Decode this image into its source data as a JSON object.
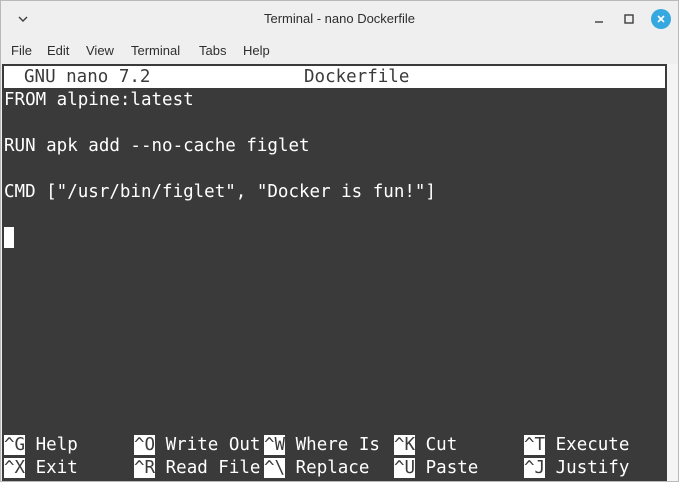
{
  "window": {
    "title": "Terminal - nano Dockerfile"
  },
  "menubar": {
    "items": [
      "File",
      "Edit",
      "View",
      "Terminal",
      "Tabs",
      "Help"
    ]
  },
  "nano": {
    "version": "GNU nano 7.2",
    "filename": "Dockerfile",
    "lines": [
      "FROM alpine:latest",
      "",
      "RUN apk add --no-cache figlet",
      "",
      "CMD [\"/usr/bin/figlet\", \"Docker is fun!\"]"
    ],
    "shortcuts": [
      {
        "key": "^G",
        "label": "Help"
      },
      {
        "key": "^O",
        "label": "Write Out"
      },
      {
        "key": "^W",
        "label": "Where Is"
      },
      {
        "key": "^K",
        "label": "Cut"
      },
      {
        "key": "^T",
        "label": "Execute"
      },
      {
        "key": "^X",
        "label": "Exit"
      },
      {
        "key": "^R",
        "label": "Read File"
      },
      {
        "key": "^\\",
        "label": "Replace"
      },
      {
        "key": "^U",
        "label": "Paste"
      },
      {
        "key": "^J",
        "label": "Justify"
      }
    ]
  },
  "icons": {
    "window_menu": "chevron-down-icon",
    "minimize": "minimize-icon",
    "maximize": "maximize-icon",
    "close": "close-icon"
  },
  "colors": {
    "terminal_bg": "#3a3a3a",
    "terminal_fg": "#ffffff",
    "close_button": "#35a8e0"
  }
}
